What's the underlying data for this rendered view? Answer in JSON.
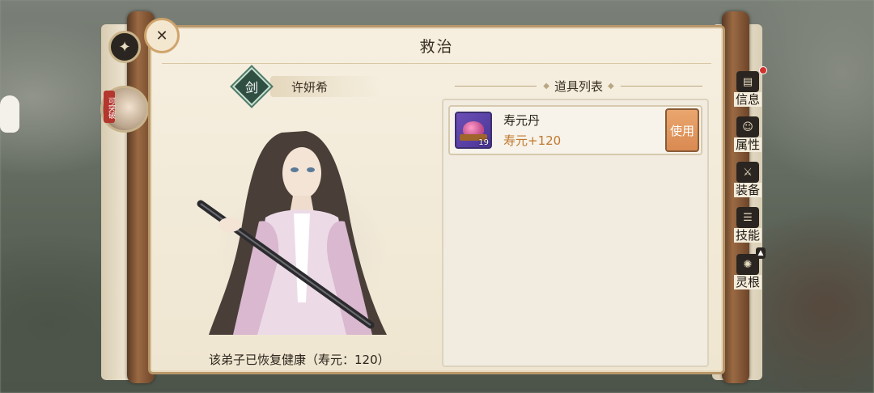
{
  "dialog": {
    "title": "救治"
  },
  "disciple": {
    "weapon_badge": "剑",
    "name": "许妍希",
    "status_text": "该弟子已恢复健康（寿元：120）"
  },
  "items": {
    "header": "道具列表",
    "list": [
      {
        "name": "寿元丹",
        "effect": "寿元+120",
        "count": "19",
        "action_label": "使用",
        "icon": "longevity-pill-icon"
      }
    ]
  },
  "side_tabs": [
    {
      "label": "信息",
      "icon": "book-icon",
      "has_alert": true
    },
    {
      "label": "属性",
      "icon": "person-icon",
      "has_alert": false
    },
    {
      "label": "装备",
      "icon": "armor-icon",
      "has_alert": false
    },
    {
      "label": "技能",
      "icon": "scroll-icon",
      "has_alert": false
    },
    {
      "label": "灵根",
      "icon": "spirit-root-icon",
      "has_alert": false,
      "locked": true
    }
  ],
  "left_rail": {
    "avatar_tag": "可突破"
  },
  "colors": {
    "accent": "#d98a51",
    "effect_text": "#c0782e",
    "panel_bg": "#f6efe0",
    "border": "#b9976a",
    "alert": "#d2322e"
  }
}
